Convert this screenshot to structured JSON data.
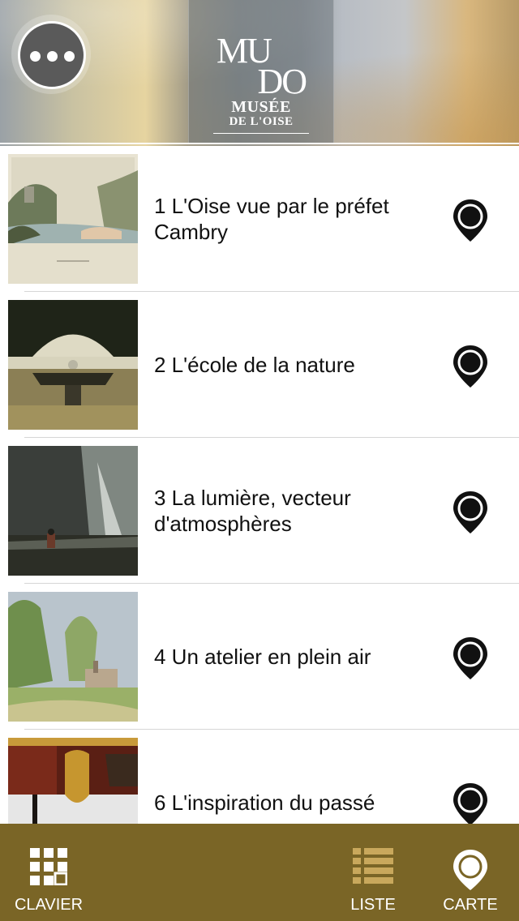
{
  "header": {
    "logo": {
      "line1": "MU",
      "line2": "DO",
      "line3": "MUSÉE",
      "line4": "DE L'OISE"
    }
  },
  "list": {
    "items": [
      {
        "title": "1 L'Oise vue par le préfet Cambry"
      },
      {
        "title": "2 L'école de la nature"
      },
      {
        "title": "3 La lumière, vecteur d'atmosphères"
      },
      {
        "title": "4 Un atelier en plein air"
      },
      {
        "title": "6 L'inspiration du passé"
      }
    ]
  },
  "tabbar": {
    "tabs": [
      {
        "label": "CLAVIER",
        "icon": "keypad-icon"
      },
      {
        "label": "LISTE",
        "icon": "list-icon"
      },
      {
        "label": "CARTE",
        "icon": "map-pin-icon"
      }
    ],
    "selected": "CARTE"
  },
  "colors": {
    "tabbar": "#7a6526",
    "tab-icon-accent": "#c9a85c",
    "pin": "#111111"
  }
}
